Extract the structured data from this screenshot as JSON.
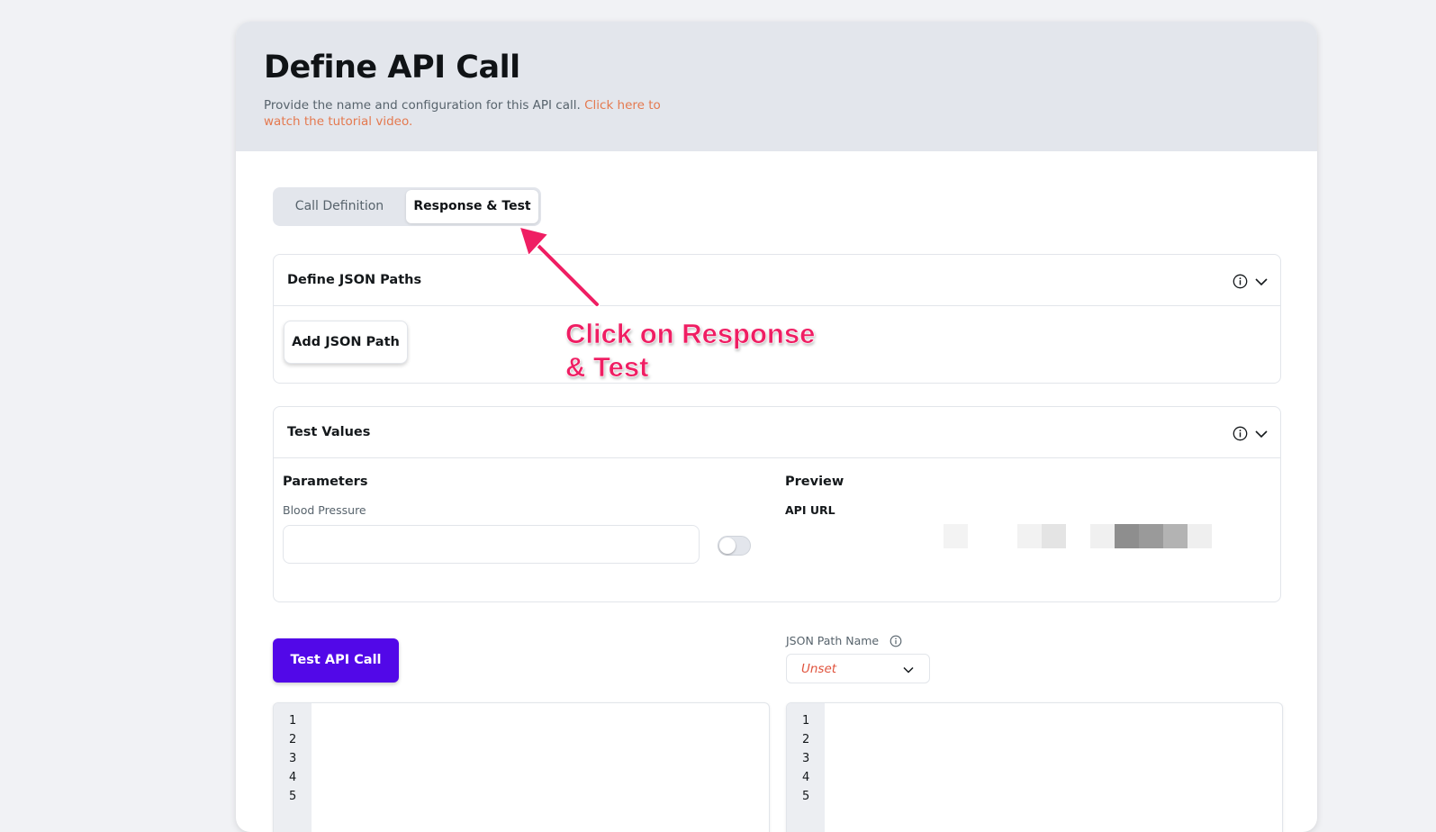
{
  "header": {
    "title": "Define API Call",
    "subtitle": "Provide the name and configuration for this API call.",
    "tutorial_link": "Click here to watch the tutorial video."
  },
  "tabs": [
    {
      "label": "Call Definition",
      "active": false
    },
    {
      "label": "Response & Test",
      "active": true
    }
  ],
  "json_paths": {
    "title": "Define JSON Paths",
    "add_button": "Add JSON Path"
  },
  "test_values": {
    "title": "Test Values",
    "parameters_heading": "Parameters",
    "param_label": "Blood Pressure",
    "param_value": "",
    "preview_heading": "Preview",
    "api_url_label": "API URL"
  },
  "test_button": "Test API Call",
  "json_path_select": {
    "label": "JSON Path Name",
    "value": "Unset"
  },
  "editors": {
    "line_numbers": [
      "1",
      "2",
      "3",
      "4",
      "5"
    ]
  },
  "annotation": {
    "text": "Click on Response\n& Test"
  },
  "colors": {
    "primary": "#5208e8",
    "link": "#e4794f",
    "unset": "#e0533d",
    "annotation": "#ef1e63"
  }
}
